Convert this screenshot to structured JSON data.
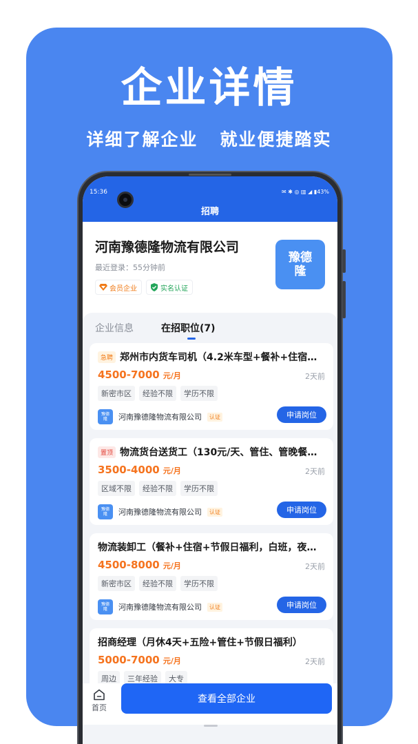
{
  "promo": {
    "title": "企业详情",
    "subtitle": "详细了解企业   就业便捷踏实"
  },
  "status_bar": {
    "time": "15:36",
    "icons": "✉ ✱ ◎ ▥ ◢ ▮43%"
  },
  "header": {
    "title": "招聘"
  },
  "company": {
    "name": "河南豫德隆物流有限公司",
    "last_login": "最近登录：55分钟前",
    "badge_member": "会员企业",
    "badge_verified": "实名认证",
    "logo_text": "豫德\n隆"
  },
  "tabs": [
    {
      "label": "企业信息",
      "active": false
    },
    {
      "label": "在招职位(7)",
      "active": true
    }
  ],
  "jobs": [
    {
      "tag": "急聘",
      "title": "郑州市内货车司机（4.2米车型+餐补+住宿+公...",
      "salary": "4500-7000",
      "salary_unit": "元/月",
      "time": "2天前",
      "reqs": [
        "新密市区",
        "经验不限",
        "学历不限"
      ],
      "company": "河南豫德隆物流有限公司",
      "verify": "认证",
      "mini_logo": "豫德\n隆",
      "apply": "申请岗位"
    },
    {
      "tag": "置顶",
      "title": "物流货台送货工（130元/天、管住、管晚餐、1...",
      "salary": "3500-4000",
      "salary_unit": "元/月",
      "time": "2天前",
      "reqs": [
        "区域不限",
        "经验不限",
        "学历不限"
      ],
      "company": "河南豫德隆物流有限公司",
      "verify": "认证",
      "mini_logo": "豫德\n隆",
      "apply": "申请岗位"
    },
    {
      "tag": "",
      "title": "物流装卸工（餐补+住宿+节假日福利，白班，夜班...",
      "salary": "4500-8000",
      "salary_unit": "元/月",
      "time": "2天前",
      "reqs": [
        "新密市区",
        "经验不限",
        "学历不限"
      ],
      "company": "河南豫德隆物流有限公司",
      "verify": "认证",
      "mini_logo": "豫德\n隆",
      "apply": "申请岗位"
    },
    {
      "tag": "",
      "title": "招商经理（月休4天+五险+管住+节假日福利）",
      "salary": "5000-7000",
      "salary_unit": "元/月",
      "time": "2天前",
      "reqs": [
        "周边",
        "三年经验",
        "大专"
      ]
    }
  ],
  "bottom": {
    "home_label": "首页",
    "view_all": "查看全部企业"
  },
  "colors": {
    "promo_bg": "#4a86f0",
    "header_blue": "#2465e6",
    "salary_orange": "#f5731e",
    "tag_orange": "#f07b18",
    "tag_red": "#e2453a",
    "verified_green": "#23a55a"
  }
}
